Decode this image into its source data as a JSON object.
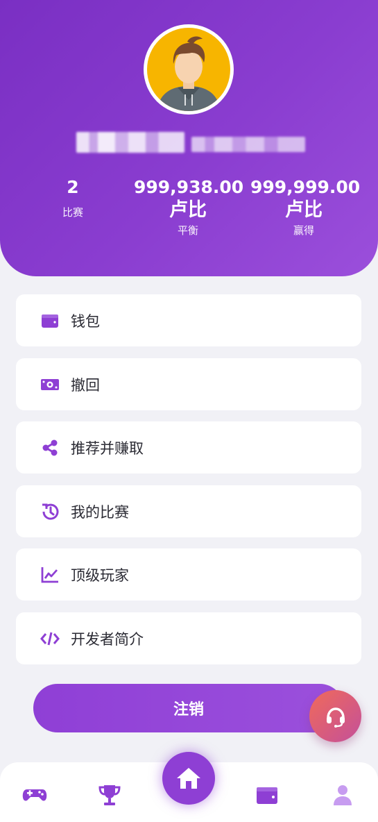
{
  "profile": {
    "stats": [
      {
        "value": "2",
        "unit": "",
        "label": "比赛"
      },
      {
        "value": "999,938.00",
        "unit": "卢比",
        "label": "平衡"
      },
      {
        "value": "999,999.00",
        "unit": "卢比",
        "label": "赢得"
      }
    ]
  },
  "menu": [
    {
      "label": "钱包",
      "icon": "wallet-icon"
    },
    {
      "label": "撤回",
      "icon": "money-icon"
    },
    {
      "label": "推荐并赚取",
      "icon": "share-icon"
    },
    {
      "label": "我的比赛",
      "icon": "history-icon"
    },
    {
      "label": "顶级玩家",
      "icon": "chart-line-icon"
    },
    {
      "label": "开发者简介",
      "icon": "code-icon"
    }
  ],
  "logout_label": "注销",
  "bottom_nav": [
    {
      "icon": "gamepad-icon"
    },
    {
      "icon": "trophy-icon"
    },
    {
      "icon": "home-icon"
    },
    {
      "icon": "wallet-icon"
    },
    {
      "icon": "user-icon"
    }
  ],
  "colors": {
    "primary": "#8e3fd4",
    "background": "#f1f1f6",
    "support_gradient_start": "#f06a5a",
    "support_gradient_end": "#c4509a"
  }
}
